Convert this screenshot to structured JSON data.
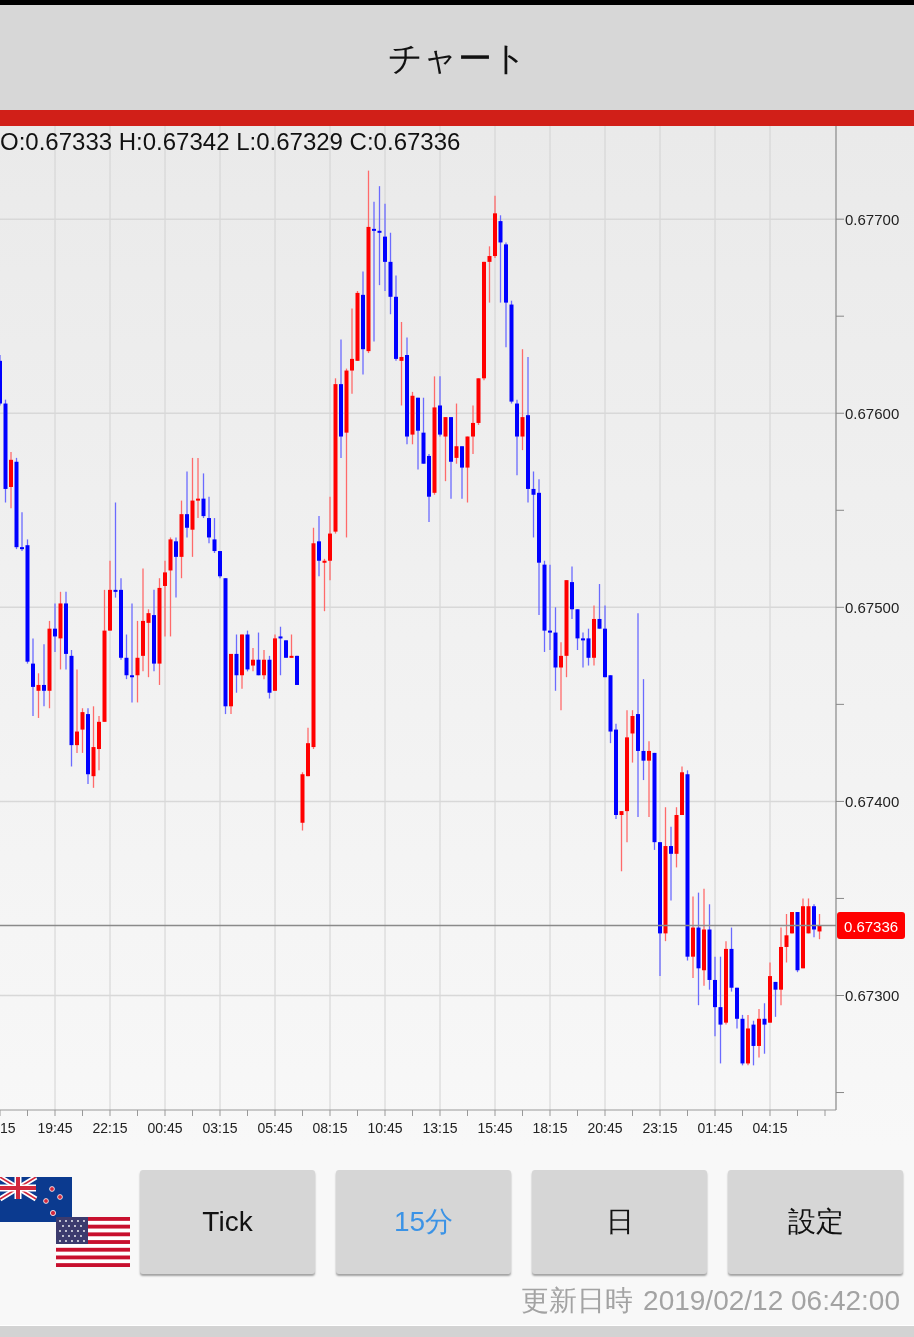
{
  "header": {
    "title": "チャート"
  },
  "chart": {
    "ohlc_readout": "O:0.67333 H:0.67342 L:0.67329 C:0.67336",
    "edge_axis_label": "15",
    "chart_data": {
      "type": "candlestick",
      "ylim": [
        0.67241,
        0.67748
      ],
      "grid": true,
      "ref_lines": [
        {
          "axis": "y",
          "value": 0.67336,
          "label": "0.67336"
        }
      ],
      "yticks": [
        {
          "value": 0.677,
          "label": "0.67700"
        },
        {
          "value": 0.676,
          "label": "0.67600"
        },
        {
          "value": 0.675,
          "label": "0.67500"
        },
        {
          "value": 0.674,
          "label": "0.67400"
        },
        {
          "value": 0.673,
          "label": "0.67300"
        }
      ],
      "categories": [
        null,
        null,
        null,
        null,
        null,
        null,
        null,
        null,
        null,
        null,
        "19:45",
        null,
        null,
        null,
        null,
        null,
        null,
        null,
        null,
        null,
        "22:15",
        null,
        null,
        null,
        null,
        null,
        null,
        null,
        null,
        null,
        "00:45",
        null,
        null,
        null,
        null,
        null,
        null,
        null,
        null,
        null,
        "03:15",
        null,
        null,
        null,
        null,
        null,
        null,
        null,
        null,
        null,
        "05:45",
        null,
        null,
        null,
        null,
        null,
        null,
        null,
        null,
        null,
        "08:15",
        null,
        null,
        null,
        null,
        null,
        null,
        null,
        null,
        null,
        "10:45",
        null,
        null,
        null,
        null,
        null,
        null,
        null,
        null,
        null,
        "13:15",
        null,
        null,
        null,
        null,
        null,
        null,
        null,
        null,
        null,
        "15:45",
        null,
        null,
        null,
        null,
        null,
        null,
        null,
        null,
        null,
        "18:15",
        null,
        null,
        null,
        null,
        null,
        null,
        null,
        null,
        null,
        "20:45",
        null,
        null,
        null,
        null,
        null,
        null,
        null,
        null,
        null,
        "23:15",
        null,
        null,
        null,
        null,
        null,
        null,
        null,
        null,
        null,
        "01:45",
        null,
        null,
        null,
        null,
        null,
        null,
        null,
        null,
        null,
        "04:15",
        null,
        null,
        null,
        null,
        null,
        null,
        null,
        null,
        null
      ],
      "ohlc": [
        [
          0.67627,
          0.6763,
          0.67604,
          0.67605
        ],
        [
          0.67605,
          0.67607,
          0.67554,
          0.67561
        ],
        [
          0.67562,
          0.6758,
          0.67551,
          0.67576
        ],
        [
          0.67575,
          0.67577,
          0.6753,
          0.67531
        ],
        [
          0.67531,
          0.67549,
          0.67529,
          0.6753
        ],
        [
          0.67532,
          0.67535,
          0.67471,
          0.67472
        ],
        [
          0.67471,
          0.67484,
          0.67444,
          0.67459
        ],
        [
          0.67457,
          0.67466,
          0.67443,
          0.6746
        ],
        [
          0.6746,
          0.67481,
          0.67449,
          0.67457
        ],
        [
          0.67457,
          0.67493,
          0.67448,
          0.67489
        ],
        [
          0.67489,
          0.67502,
          0.67477,
          0.67485
        ],
        [
          0.67484,
          0.67508,
          0.67468,
          0.67502
        ],
        [
          0.67502,
          0.67508,
          0.67468,
          0.67476
        ],
        [
          0.67475,
          0.67478,
          0.67418,
          0.67429
        ],
        [
          0.67429,
          0.67468,
          0.67425,
          0.67436
        ],
        [
          0.67437,
          0.67448,
          0.67425,
          0.67446
        ],
        [
          0.67445,
          0.67448,
          0.67409,
          0.67414
        ],
        [
          0.67413,
          0.67449,
          0.67407,
          0.67428
        ],
        [
          0.67427,
          0.67444,
          0.67416,
          0.67441
        ],
        [
          0.67441,
          0.67509,
          0.67441,
          0.67488
        ],
        [
          0.67488,
          0.67524,
          0.67488,
          0.67509
        ],
        [
          0.67509,
          0.67554,
          0.67505,
          0.67508
        ],
        [
          0.67509,
          0.67515,
          0.67473,
          0.67474
        ],
        [
          0.67474,
          0.67486,
          0.67463,
          0.67465
        ],
        [
          0.67465,
          0.67502,
          0.67451,
          0.67464
        ],
        [
          0.67465,
          0.67493,
          0.67451,
          0.67474
        ],
        [
          0.67475,
          0.6752,
          0.67467,
          0.67493
        ],
        [
          0.67492,
          0.67499,
          0.67464,
          0.67497
        ],
        [
          0.67496,
          0.67509,
          0.67467,
          0.67471
        ],
        [
          0.67471,
          0.67515,
          0.6746,
          0.6751
        ],
        [
          0.67511,
          0.67524,
          0.67485,
          0.67518
        ],
        [
          0.67519,
          0.67536,
          0.67485,
          0.67535
        ],
        [
          0.67534,
          0.67536,
          0.67505,
          0.67526
        ],
        [
          0.67526,
          0.67555,
          0.67515,
          0.67548
        ],
        [
          0.67548,
          0.6757,
          0.67536,
          0.67541
        ],
        [
          0.6754,
          0.67577,
          0.67526,
          0.67555
        ],
        [
          0.67555,
          0.67577,
          0.67546,
          0.67556
        ],
        [
          0.67556,
          0.67569,
          0.67546,
          0.67547
        ],
        [
          0.67546,
          0.67557,
          0.67533,
          0.67536
        ],
        [
          0.67535,
          0.67546,
          0.67528,
          0.67529
        ],
        [
          0.67529,
          0.67529,
          0.67515,
          0.67516
        ],
        [
          0.67515,
          0.67515,
          0.67445,
          0.67449
        ],
        [
          0.67449,
          0.67476,
          0.67445,
          0.67476
        ],
        [
          0.67476,
          0.67486,
          0.67456,
          0.67465
        ],
        [
          0.67465,
          0.67486,
          0.67458,
          0.67486
        ],
        [
          0.67486,
          0.67488,
          0.67467,
          0.67468
        ],
        [
          0.6747,
          0.67479,
          0.67467,
          0.67473
        ],
        [
          0.67473,
          0.67487,
          0.67465,
          0.67465
        ],
        [
          0.67465,
          0.67478,
          0.67463,
          0.67473
        ],
        [
          0.67473,
          0.67475,
          0.67453,
          0.67456
        ],
        [
          0.67457,
          0.67486,
          0.67457,
          0.67484
        ],
        [
          0.67485,
          0.6749,
          0.67465,
          0.67484
        ],
        [
          0.67483,
          0.67483,
          0.67474,
          0.67474
        ],
        [
          0.67474,
          0.67486,
          0.67474,
          0.67475
        ],
        [
          0.67475,
          0.67475,
          0.6746,
          0.6746
        ],
        [
          0.67389,
          0.67415,
          0.67385,
          0.67414
        ],
        [
          0.67413,
          0.67438,
          0.67413,
          0.6743
        ],
        [
          0.67428,
          0.67541,
          0.67427,
          0.67533
        ],
        [
          0.67534,
          0.67547,
          0.67516,
          0.67524
        ],
        [
          0.67523,
          0.67525,
          0.67498,
          0.67524
        ],
        [
          0.67524,
          0.67557,
          0.67514,
          0.67538
        ],
        [
          0.67539,
          0.67618,
          0.67538,
          0.67615
        ],
        [
          0.67615,
          0.67638,
          0.67577,
          0.67588
        ],
        [
          0.6759,
          0.67623,
          0.67536,
          0.67622
        ],
        [
          0.67622,
          0.67654,
          0.6761,
          0.67628
        ],
        [
          0.67627,
          0.67663,
          0.67627,
          0.67662
        ],
        [
          0.67661,
          0.67673,
          0.6762,
          0.67633
        ],
        [
          0.67632,
          0.67725,
          0.67631,
          0.67696
        ],
        [
          0.67695,
          0.67709,
          0.67637,
          0.67694
        ],
        [
          0.67694,
          0.67717,
          0.67666,
          0.67693
        ],
        [
          0.67691,
          0.67708,
          0.67663,
          0.67678
        ],
        [
          0.67678,
          0.67693,
          0.67651,
          0.6766
        ],
        [
          0.6766,
          0.67671,
          0.67627,
          0.67628
        ],
        [
          0.67627,
          0.67647,
          0.67604,
          0.67629
        ],
        [
          0.6763,
          0.67639,
          0.67584,
          0.67588
        ],
        [
          0.67589,
          0.67611,
          0.67584,
          0.67609
        ],
        [
          0.67608,
          0.67608,
          0.67571,
          0.67591
        ],
        [
          0.6759,
          0.67608,
          0.67574,
          0.67574
        ],
        [
          0.67578,
          0.67579,
          0.67544,
          0.67557
        ],
        [
          0.67559,
          0.67619,
          0.67558,
          0.67603
        ],
        [
          0.67604,
          0.67619,
          0.67588,
          0.67589
        ],
        [
          0.67588,
          0.67598,
          0.67565,
          0.67598
        ],
        [
          0.67598,
          0.67598,
          0.67556,
          0.67575
        ],
        [
          0.67577,
          0.67605,
          0.67574,
          0.67583
        ],
        [
          0.67583,
          0.67583,
          0.67556,
          0.67572
        ],
        [
          0.67572,
          0.67588,
          0.67554,
          0.67588
        ],
        [
          0.67588,
          0.67604,
          0.67579,
          0.67595
        ],
        [
          0.67595,
          0.67618,
          0.67594,
          0.67618
        ],
        [
          0.67618,
          0.67678,
          0.67617,
          0.67678
        ],
        [
          0.67678,
          0.67686,
          0.67657,
          0.67681
        ],
        [
          0.67681,
          0.67712,
          0.6768,
          0.67703
        ],
        [
          0.67699,
          0.67702,
          0.67657,
          0.67688
        ],
        [
          0.67687,
          0.67688,
          0.67634,
          0.67657
        ],
        [
          0.67656,
          0.67658,
          0.67605,
          0.67606
        ],
        [
          0.67605,
          0.67607,
          0.67568,
          0.67588
        ],
        [
          0.67588,
          0.67633,
          0.67581,
          0.67598
        ],
        [
          0.67599,
          0.67629,
          0.67554,
          0.67561
        ],
        [
          0.67561,
          0.6757,
          0.67536,
          0.67558
        ],
        [
          0.67559,
          0.67566,
          0.67496,
          0.67523
        ],
        [
          0.67522,
          0.67524,
          0.67477,
          0.67488
        ],
        [
          0.67488,
          0.67522,
          0.67478,
          0.67487
        ],
        [
          0.67487,
          0.675,
          0.67457,
          0.67469
        ],
        [
          0.67469,
          0.67482,
          0.67447,
          0.67475
        ],
        [
          0.67475,
          0.67514,
          0.67464,
          0.67514
        ],
        [
          0.67513,
          0.67521,
          0.67494,
          0.67499
        ],
        [
          0.67499,
          0.67499,
          0.67478,
          0.67484
        ],
        [
          0.67484,
          0.67487,
          0.67469,
          0.67483
        ],
        [
          0.67484,
          0.67489,
          0.6747,
          0.67474
        ],
        [
          0.67474,
          0.67501,
          0.6747,
          0.67494
        ],
        [
          0.67494,
          0.67512,
          0.67489,
          0.67489
        ],
        [
          0.67489,
          0.67501,
          0.67464,
          0.67464
        ],
        [
          0.67465,
          0.67465,
          0.6743,
          0.67436
        ],
        [
          0.67437,
          0.6744,
          0.67391,
          0.67393
        ],
        [
          0.67393,
          0.67395,
          0.67364,
          0.67395
        ],
        [
          0.67395,
          0.67447,
          0.67379,
          0.67433
        ],
        [
          0.67435,
          0.67447,
          0.6742,
          0.67444
        ],
        [
          0.67445,
          0.67497,
          0.67392,
          0.67426
        ],
        [
          0.67426,
          0.67463,
          0.67411,
          0.67421
        ],
        [
          0.67421,
          0.67431,
          0.67392,
          0.67426
        ],
        [
          0.67425,
          0.67425,
          0.67375,
          0.67379
        ],
        [
          0.67379,
          0.67379,
          0.6731,
          0.67332
        ],
        [
          0.67332,
          0.67397,
          0.67328,
          0.67377
        ],
        [
          0.67377,
          0.67387,
          0.67349,
          0.67373
        ],
        [
          0.67373,
          0.67397,
          0.67366,
          0.67393
        ],
        [
          0.67393,
          0.67418,
          0.67393,
          0.67415
        ],
        [
          0.67414,
          0.67416,
          0.67318,
          0.6732
        ],
        [
          0.6732,
          0.67351,
          0.67309,
          0.67335
        ],
        [
          0.67335,
          0.67353,
          0.67295,
          0.67314
        ],
        [
          0.67313,
          0.67355,
          0.67305,
          0.67334
        ],
        [
          0.67334,
          0.67347,
          0.67303,
          0.67308
        ],
        [
          0.67308,
          0.6732,
          0.67279,
          0.67294
        ],
        [
          0.67294,
          0.6732,
          0.67265,
          0.67285
        ],
        [
          0.67286,
          0.67328,
          0.67285,
          0.67324
        ],
        [
          0.67324,
          0.67335,
          0.67302,
          0.67304
        ],
        [
          0.67304,
          0.67304,
          0.67283,
          0.67288
        ],
        [
          0.67288,
          0.6729,
          0.67264,
          0.67265
        ],
        [
          0.67265,
          0.6729,
          0.67264,
          0.67283
        ],
        [
          0.67285,
          0.67287,
          0.67264,
          0.67274
        ],
        [
          0.67274,
          0.67293,
          0.67268,
          0.67288
        ],
        [
          0.67288,
          0.67296,
          0.6727,
          0.67285
        ],
        [
          0.67286,
          0.67317,
          0.67286,
          0.6731
        ],
        [
          0.67307,
          0.67307,
          0.67289,
          0.67303
        ],
        [
          0.67303,
          0.67335,
          0.67295,
          0.67325
        ],
        [
          0.67325,
          0.67342,
          0.67317,
          0.67331
        ],
        [
          0.67332,
          0.67343,
          0.67332,
          0.67343
        ],
        [
          0.67343,
          0.67343,
          0.67312,
          0.67313
        ],
        [
          0.67314,
          0.6735,
          0.67314,
          0.67346
        ],
        [
          0.67332,
          0.6735,
          0.67332,
          0.67346
        ],
        [
          0.67346,
          0.67347,
          0.6733,
          0.67334
        ],
        [
          0.67333,
          0.67342,
          0.67329,
          0.67336
        ]
      ]
    }
  },
  "timeframe_tabs": [
    {
      "label": "Tick",
      "selected": false
    },
    {
      "label": "15分",
      "selected": true
    },
    {
      "label": "日",
      "selected": false
    }
  ],
  "settings_button": {
    "label": "設定"
  },
  "update_time": {
    "label": "更新日時",
    "value": "2019/02/12 06:42:00"
  }
}
